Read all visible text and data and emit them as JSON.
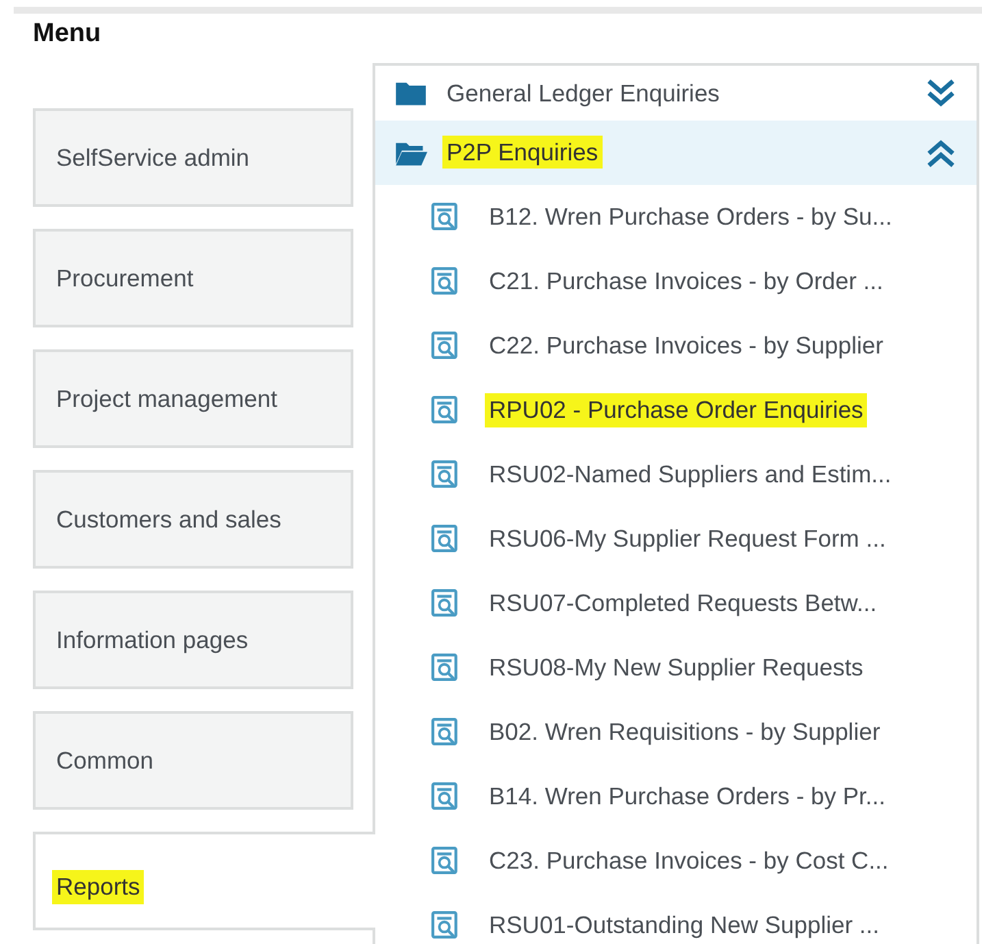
{
  "menu": {
    "title": "Menu",
    "items": [
      {
        "label": "SelfService admin",
        "selected": false,
        "highlighted": false
      },
      {
        "label": "Procurement",
        "selected": false,
        "highlighted": false
      },
      {
        "label": "Project management",
        "selected": false,
        "highlighted": false
      },
      {
        "label": "Customers and sales",
        "selected": false,
        "highlighted": false
      },
      {
        "label": "Information pages",
        "selected": false,
        "highlighted": false
      },
      {
        "label": "Common",
        "selected": false,
        "highlighted": false
      },
      {
        "label": "Reports",
        "selected": true,
        "highlighted": true
      }
    ]
  },
  "panel": {
    "groups": [
      {
        "label": "General Ledger Enquiries",
        "expanded": false,
        "highlighted": false
      },
      {
        "label": "P2P Enquiries",
        "expanded": true,
        "highlighted": true,
        "items": [
          {
            "label": "B12. Wren Purchase Orders - by Su...",
            "highlighted": false
          },
          {
            "label": "C21. Purchase Invoices - by Order ...",
            "highlighted": false
          },
          {
            "label": "C22. Purchase Invoices - by Supplier",
            "highlighted": false
          },
          {
            "label": "RPU02 - Purchase Order Enquiries",
            "highlighted": true
          },
          {
            "label": "RSU02-Named Suppliers and Estim...",
            "highlighted": false
          },
          {
            "label": "RSU06-My Supplier Request Form ...",
            "highlighted": false
          },
          {
            "label": "RSU07-Completed Requests Betw...",
            "highlighted": false
          },
          {
            "label": "RSU08-My New Supplier Requests",
            "highlighted": false
          },
          {
            "label": "B02. Wren Requisitions - by Supplier",
            "highlighted": false
          },
          {
            "label": "B14. Wren Purchase Orders - by Pr...",
            "highlighted": false
          },
          {
            "label": "C23. Purchase Invoices - by Cost C...",
            "highlighted": false
          },
          {
            "label": "RSU01-Outstanding New Supplier ...",
            "highlighted": false
          }
        ]
      }
    ]
  }
}
